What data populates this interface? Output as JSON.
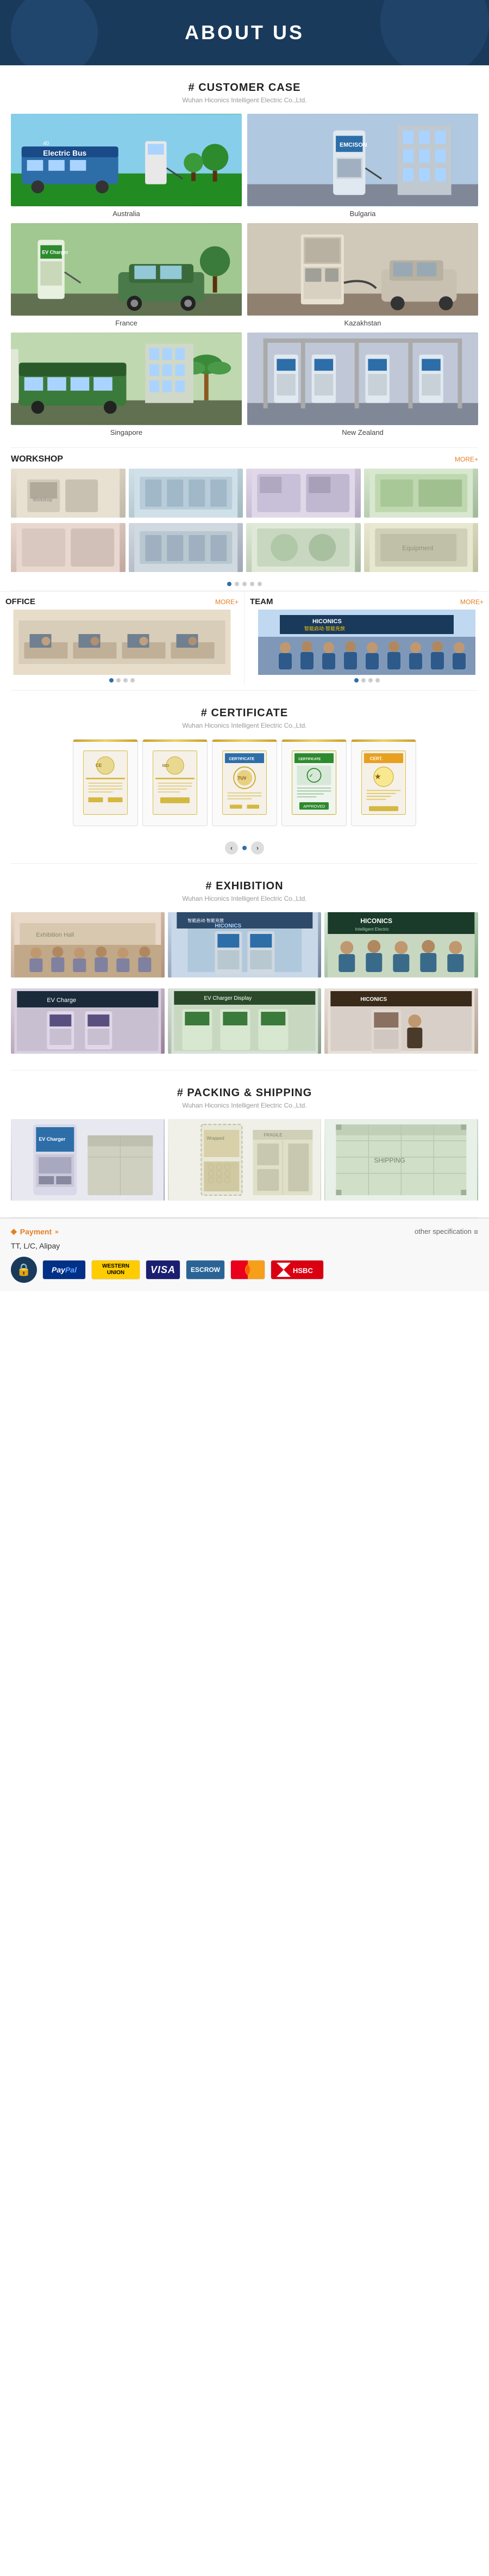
{
  "hero": {
    "title": "ABOUT US"
  },
  "customer_case": {
    "section_title": "# CUSTOMER CASE",
    "subtitle": "Wuhan Hiconics Intelligent Electric Co.,Ltd.",
    "items": [
      {
        "label": "Australia",
        "class": "photo-bus"
      },
      {
        "label": "Bulgaria",
        "class": "photo-charger-blue"
      },
      {
        "label": "France",
        "class": "photo-charger-green"
      },
      {
        "label": "Kazakhstan",
        "class": "photo-charger-industrial"
      },
      {
        "label": "Singapore",
        "class": "photo-bus-green"
      },
      {
        "label": "New Zealand",
        "class": "photo-charger-nz"
      }
    ]
  },
  "workshop": {
    "title": "WORKSHOP",
    "more_label": "MORE+",
    "dots": [
      true,
      false,
      false,
      false,
      false
    ]
  },
  "office": {
    "title": "OFFICE",
    "more_label": "MORE+",
    "dots": [
      true,
      false,
      false,
      false
    ]
  },
  "team": {
    "title": "TEAM",
    "more_label": "MORE+",
    "dots": [
      true,
      false,
      false,
      false
    ]
  },
  "certificate": {
    "section_title": "# CERTIFICATE",
    "subtitle": "Wuhan Hiconics Intelligent Electric Co.,Ltd.",
    "count": 5
  },
  "exhibition": {
    "section_title": "# EXHIBITION",
    "subtitle": "Wuhan Hiconics Intelligent Electric Co.,Ltd.",
    "row1": [
      "photo-exhib1",
      "photo-exhib2",
      "photo-exhib3"
    ],
    "row2": [
      "photo-exhib4",
      "photo-exhib5",
      "photo-exhib6"
    ]
  },
  "packing": {
    "section_title": "# PACKING & SHIPPING",
    "subtitle": "Wuhan Hiconics Intelligent Electric Co.,Ltd.",
    "items": [
      "photo-pack1",
      "photo-pack2",
      "photo-pack3"
    ]
  },
  "payment": {
    "label": "Payment",
    "chevron": "»",
    "other_spec": "other specification",
    "methods_text": "TT, L/C, Alipay",
    "logos": [
      {
        "name": "paypal",
        "text": "PayPal",
        "class": "paypal-logo"
      },
      {
        "name": "western-union",
        "text": "WESTERN UNION",
        "class": "western-union-logo"
      },
      {
        "name": "visa",
        "text": "VISA",
        "class": "visa-logo"
      },
      {
        "name": "escrow",
        "text": "ESCROW",
        "class": "escrow-logo"
      },
      {
        "name": "mastercard",
        "text": "MasterCard",
        "class": "mastercard-logo"
      },
      {
        "name": "hsbc",
        "text": "HSBC ✕✕",
        "class": "hsbc-logo"
      }
    ]
  }
}
